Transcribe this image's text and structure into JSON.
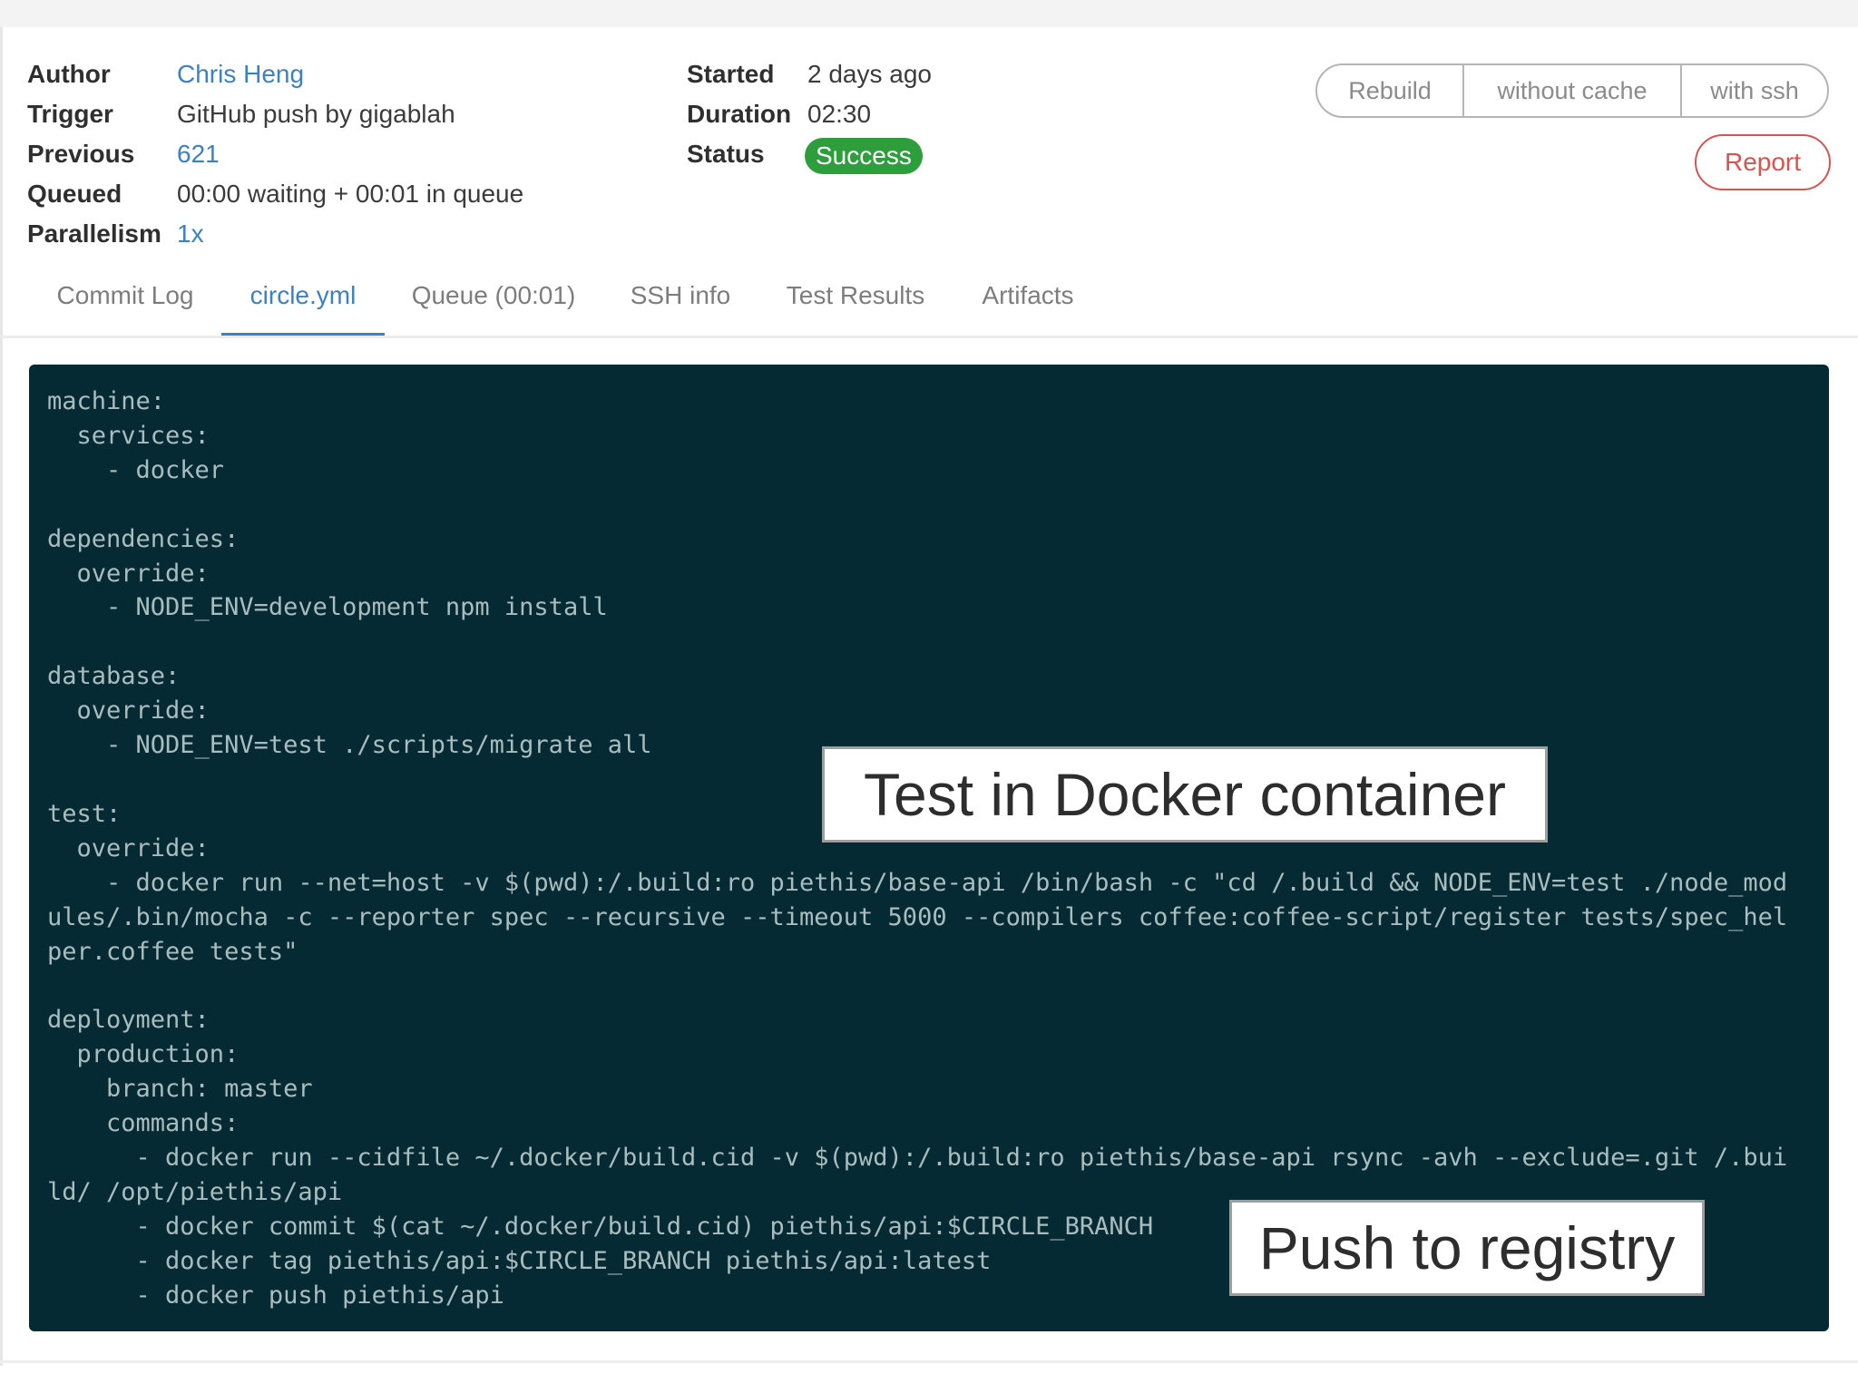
{
  "build": {
    "author_label": "Author",
    "author_value": "Chris Heng",
    "trigger_label": "Trigger",
    "trigger_value": "GitHub push by gigablah",
    "previous_label": "Previous",
    "previous_value": "621",
    "queued_label": "Queued",
    "queued_value": "00:00 waiting + 00:01 in queue",
    "parallelism_label": "Parallelism",
    "parallelism_value": "1x",
    "started_label": "Started",
    "started_value": "2 days ago",
    "duration_label": "Duration",
    "duration_value": "02:30",
    "status_label": "Status",
    "status_value": "Success"
  },
  "actions": {
    "rebuild_label": "Rebuild",
    "without_cache_label": "without cache",
    "with_ssh_label": "with ssh",
    "report_label": "Report"
  },
  "tabs": [
    {
      "label": "Commit Log",
      "active": false
    },
    {
      "label": "circle.yml",
      "active": true
    },
    {
      "label": "Queue (00:01)",
      "active": false
    },
    {
      "label": "SSH info",
      "active": false
    },
    {
      "label": "Test Results",
      "active": false
    },
    {
      "label": "Artifacts",
      "active": false
    }
  ],
  "code": {
    "content": "machine:\n  services:\n    - docker\n\ndependencies:\n  override:\n    - NODE_ENV=development npm install\n\ndatabase:\n  override:\n    - NODE_ENV=test ./scripts/migrate all\n\ntest:\n  override:\n    - docker run --net=host -v $(pwd):/.build:ro piethis/base-api /bin/bash -c \"cd /.build && NODE_ENV=test ./node_mod\nules/.bin/mocha -c --reporter spec --recursive --timeout 5000 --compilers coffee:coffee-script/register tests/spec_hel\nper.coffee tests\"\n\ndeployment:\n  production:\n    branch: master\n    commands:\n      - docker run --cidfile ~/.docker/build.cid -v $(pwd):/.build:ro piethis/base-api rsync -avh --exclude=.git /.bui\nld/ /opt/piethis/api\n      - docker commit $(cat ~/.docker/build.cid) piethis/api:$CIRCLE_BRANCH\n      - docker tag piethis/api:$CIRCLE_BRANCH piethis/api:latest\n      - docker push piethis/api"
  },
  "annotations": {
    "docker_test": "Test in Docker container",
    "push_registry": "Push to registry"
  },
  "colors": {
    "link": "#3a82c4",
    "success": "#2e9e3c",
    "danger": "#d9534f",
    "code_bg": "#062a33",
    "code_text": "#a9bdbf"
  }
}
